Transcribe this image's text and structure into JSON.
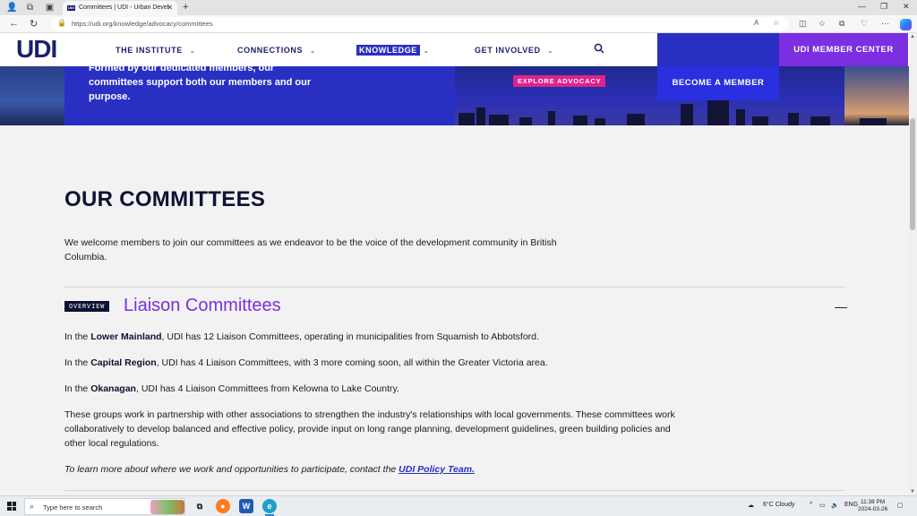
{
  "browser": {
    "tab_title": "Committees | UDI - Urban Devel",
    "tab_favicon_text": "UDI",
    "url": "https://udi.org/knowledge/advocacy/committees"
  },
  "header": {
    "logo": "UDI",
    "menu": [
      {
        "label": "THE INSTITUTE"
      },
      {
        "label": "CONNECTIONS"
      },
      {
        "label": "KNOWLEDGE"
      },
      {
        "label": "GET INVOLVED"
      }
    ],
    "member_center": "UDI MEMBER CENTER"
  },
  "hero": {
    "text": "Formed by our dedicated members, our committees support both our members and our purpose.",
    "explore_label": "EXPLORE ADVOCACY",
    "become_member": "BECOME A MEMBER"
  },
  "main": {
    "title": "OUR COMMITTEES",
    "intro": "We welcome members to join our committees as we endeavor to be the voice of the development community in British Columbia.",
    "section": {
      "badge": "OVERVIEW",
      "title": "Liaison Committees",
      "collapse_symbol": "—",
      "p1": {
        "pre": "In the ",
        "bold": "Lower Mainland",
        "post": ", UDI has 12 Liaison Committees, operating in municipalities from Squamish to Abbotsford."
      },
      "p2": {
        "pre": "In the ",
        "bold": "Capital Region",
        "post": ", UDI has 4 Liaison Committees, with 3 more coming soon, all within the Greater Victoria area."
      },
      "p3": {
        "pre": "In the ",
        "bold": "Okanagan",
        "post": ", UDI has 4 Liaison Committees from Kelowna to Lake Country."
      },
      "p4": "These groups work in partnership with other associations to strengthen the industry's relationships with local governments. These committees work collaboratively to develop balanced and effective policy, provide input on long range planning, development guidelines, green building policies and other local regulations.",
      "p5_text": "To learn more about where we work and opportunities to participate, contact the ",
      "p5_link": "UDI Policy Team."
    }
  },
  "taskbar": {
    "search_placeholder": "Type here to search",
    "weather": "6°C  Cloudy",
    "lang": "ENG",
    "time": "11:38 PM",
    "date": "2024-03-26"
  }
}
